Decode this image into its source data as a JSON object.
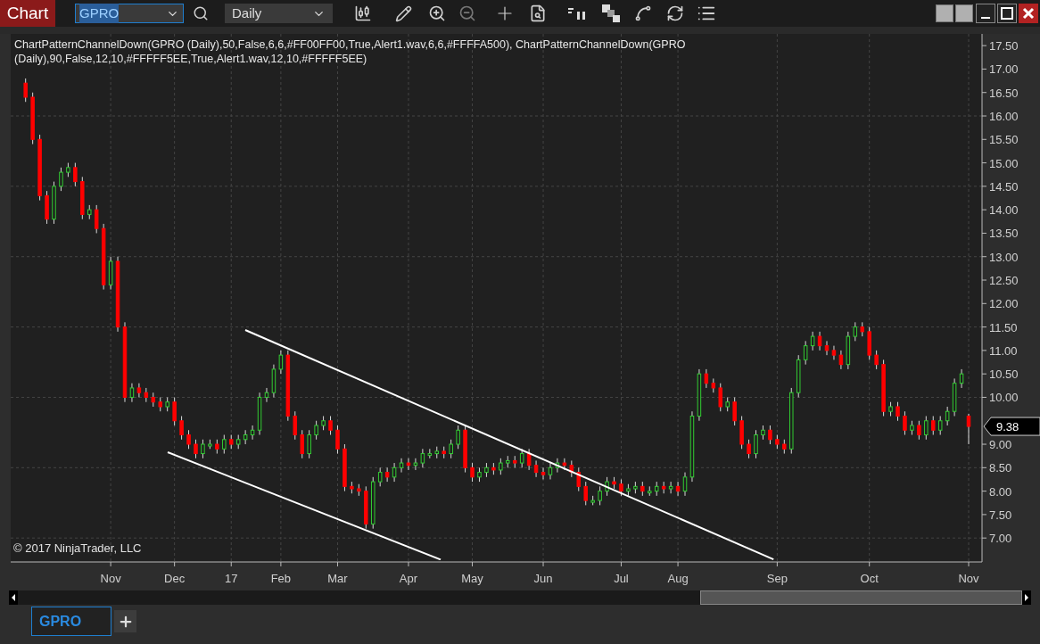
{
  "window": {
    "title": "Chart"
  },
  "toolbar": {
    "instrument": "GPRO",
    "interval": "Daily"
  },
  "chart": {
    "indicator_label_lines": [
      "ChartPatternChannelDown(GPRO (Daily),50,False,6,6,#FF00FF00,True,Alert1.wav,6,6,#FFFFA500), ChartPatternChannelDown(GPRO",
      "(Daily),90,False,12,10,#FFFFF5EE,True,Alert1.wav,12,10,#FFFFF5EE)"
    ],
    "copyright": "© 2017 NinjaTrader, LLC",
    "last_price": "9.38",
    "chart_data": {
      "type": "candlestick",
      "grid": true,
      "ylim": [
        6.49,
        17.75
      ],
      "yticks": [
        {
          "value": 7,
          "label": "7.00"
        },
        {
          "value": 7.5,
          "label": "7.50"
        },
        {
          "value": 8,
          "label": "8.00"
        },
        {
          "value": 8.5,
          "label": "8.50"
        },
        {
          "value": 9,
          "label": "9.00"
        },
        {
          "value": 10,
          "label": "10.00"
        },
        {
          "value": 10.5,
          "label": "10.50"
        },
        {
          "value": 11,
          "label": "11.00"
        },
        {
          "value": 11.5,
          "label": "11.50"
        },
        {
          "value": 12,
          "label": "12.00"
        },
        {
          "value": 12.5,
          "label": "12.50"
        },
        {
          "value": 13,
          "label": "13.00"
        },
        {
          "value": 13.5,
          "label": "13.50"
        },
        {
          "value": 14,
          "label": "14.00"
        },
        {
          "value": 14.5,
          "label": "14.50"
        },
        {
          "value": 15,
          "label": "15.00"
        },
        {
          "value": 15.5,
          "label": "15.50"
        },
        {
          "value": 16,
          "label": "16.00"
        },
        {
          "value": 16.5,
          "label": "16.50"
        },
        {
          "value": 17,
          "label": "17.00"
        },
        {
          "value": 17.5,
          "label": "17.50"
        }
      ],
      "categories": [
        null,
        null,
        null,
        null,
        null,
        null,
        null,
        null,
        null,
        null,
        null,
        null,
        "Nov",
        null,
        null,
        null,
        null,
        null,
        null,
        null,
        null,
        "Dec",
        null,
        null,
        null,
        null,
        null,
        null,
        null,
        "17",
        null,
        null,
        null,
        null,
        null,
        null,
        "Feb",
        null,
        null,
        null,
        null,
        null,
        null,
        null,
        "Mar",
        null,
        null,
        null,
        null,
        null,
        null,
        null,
        null,
        null,
        "Apr",
        null,
        null,
        null,
        null,
        null,
        null,
        null,
        null,
        "May",
        null,
        null,
        null,
        null,
        null,
        null,
        null,
        null,
        null,
        "Jun",
        null,
        null,
        null,
        null,
        null,
        null,
        null,
        null,
        null,
        null,
        "Jul",
        null,
        null,
        null,
        null,
        null,
        null,
        null,
        "Aug",
        null,
        null,
        null,
        null,
        null,
        null,
        null,
        null,
        null,
        null,
        null,
        null,
        null,
        "Sep",
        null,
        null,
        null,
        null,
        null,
        null,
        null,
        null,
        null,
        null,
        null,
        null,
        "Oct",
        null,
        null,
        null,
        null,
        null,
        null,
        null,
        null,
        null,
        null,
        null,
        null,
        null,
        "Nov"
      ],
      "ohlc": [
        [
          16.7,
          16.8,
          16.3,
          16.4
        ],
        [
          16.4,
          16.5,
          15.4,
          15.5
        ],
        [
          15.5,
          15.6,
          14.2,
          14.3
        ],
        [
          14.3,
          14.4,
          13.7,
          13.8
        ],
        [
          13.8,
          14.6,
          13.7,
          14.5
        ],
        [
          14.5,
          14.9,
          14.4,
          14.8
        ],
        [
          14.8,
          15.0,
          14.7,
          14.9
        ],
        [
          14.9,
          15.0,
          14.5,
          14.6
        ],
        [
          14.6,
          14.7,
          13.8,
          13.9
        ],
        [
          13.9,
          14.1,
          13.8,
          14.0
        ],
        [
          14.0,
          14.1,
          13.5,
          13.6
        ],
        [
          13.6,
          13.7,
          12.3,
          12.4
        ],
        [
          12.4,
          13.0,
          12.3,
          12.9
        ],
        [
          12.9,
          13.0,
          11.4,
          11.5
        ],
        [
          11.5,
          11.6,
          9.9,
          10.0
        ],
        [
          10.0,
          10.3,
          9.9,
          10.2
        ],
        [
          10.2,
          10.3,
          10.0,
          10.1
        ],
        [
          10.1,
          10.2,
          9.9,
          10.0
        ],
        [
          10.0,
          10.1,
          9.8,
          9.9
        ],
        [
          9.9,
          10.0,
          9.7,
          9.8
        ],
        [
          9.8,
          10.0,
          9.7,
          9.9
        ],
        [
          9.9,
          10.0,
          9.4,
          9.5
        ],
        [
          9.5,
          9.6,
          9.1,
          9.2
        ],
        [
          9.2,
          9.3,
          8.9,
          9.0
        ],
        [
          9.0,
          9.1,
          8.7,
          8.8
        ],
        [
          8.8,
          9.1,
          8.7,
          9.0
        ],
        [
          9.0,
          9.1,
          8.9,
          9.0
        ],
        [
          9.0,
          9.1,
          8.8,
          8.9
        ],
        [
          8.9,
          9.2,
          8.8,
          9.1
        ],
        [
          9.1,
          9.2,
          8.9,
          9.0
        ],
        [
          9.0,
          9.2,
          8.9,
          9.1
        ],
        [
          9.1,
          9.3,
          9.0,
          9.2
        ],
        [
          9.2,
          9.4,
          9.1,
          9.3
        ],
        [
          9.3,
          10.1,
          9.2,
          10.0
        ],
        [
          10.0,
          10.2,
          9.9,
          10.1
        ],
        [
          10.1,
          10.7,
          10.0,
          10.6
        ],
        [
          10.6,
          11.0,
          10.5,
          10.9
        ],
        [
          10.9,
          11.0,
          9.5,
          9.6
        ],
        [
          9.6,
          9.7,
          9.1,
          9.2
        ],
        [
          9.2,
          9.3,
          8.7,
          8.8
        ],
        [
          8.8,
          9.3,
          8.7,
          9.2
        ],
        [
          9.2,
          9.5,
          9.1,
          9.4
        ],
        [
          9.4,
          9.6,
          9.3,
          9.5
        ],
        [
          9.5,
          9.6,
          9.2,
          9.3
        ],
        [
          9.3,
          9.4,
          8.8,
          8.9
        ],
        [
          8.9,
          9.0,
          8.0,
          8.1
        ],
        [
          8.1,
          8.2,
          7.95,
          8.05
        ],
        [
          8.05,
          8.15,
          7.9,
          8.0
        ],
        [
          8.0,
          8.1,
          7.2,
          7.3
        ],
        [
          7.3,
          8.3,
          7.2,
          8.2
        ],
        [
          8.2,
          8.5,
          8.1,
          8.4
        ],
        [
          8.4,
          8.5,
          8.2,
          8.3
        ],
        [
          8.3,
          8.6,
          8.2,
          8.5
        ],
        [
          8.5,
          8.7,
          8.4,
          8.6
        ],
        [
          8.6,
          8.7,
          8.45,
          8.55
        ],
        [
          8.55,
          8.7,
          8.45,
          8.6
        ],
        [
          8.6,
          8.9,
          8.5,
          8.8
        ],
        [
          8.8,
          8.9,
          8.7,
          8.8
        ],
        [
          8.8,
          8.95,
          8.7,
          8.85
        ],
        [
          8.85,
          8.95,
          8.7,
          8.8
        ],
        [
          8.8,
          9.1,
          8.7,
          9.0
        ],
        [
          9.0,
          9.4,
          8.9,
          9.3
        ],
        [
          9.3,
          9.4,
          8.4,
          8.5
        ],
        [
          8.5,
          8.6,
          8.2,
          8.3
        ],
        [
          8.3,
          8.5,
          8.2,
          8.4
        ],
        [
          8.4,
          8.6,
          8.3,
          8.5
        ],
        [
          8.5,
          8.6,
          8.35,
          8.45
        ],
        [
          8.45,
          8.7,
          8.35,
          8.6
        ],
        [
          8.6,
          8.75,
          8.5,
          8.65
        ],
        [
          8.65,
          8.75,
          8.5,
          8.6
        ],
        [
          8.6,
          8.9,
          8.5,
          8.8
        ],
        [
          8.8,
          8.9,
          8.45,
          8.55
        ],
        [
          8.55,
          8.65,
          8.3,
          8.4
        ],
        [
          8.4,
          8.5,
          8.25,
          8.35
        ],
        [
          8.35,
          8.6,
          8.25,
          8.5
        ],
        [
          8.5,
          8.7,
          8.4,
          8.6
        ],
        [
          8.6,
          8.7,
          8.45,
          8.55
        ],
        [
          8.55,
          8.65,
          8.3,
          8.4
        ],
        [
          8.4,
          8.5,
          8.0,
          8.1
        ],
        [
          8.1,
          8.2,
          7.7,
          7.8
        ],
        [
          7.8,
          7.9,
          7.7,
          7.8
        ],
        [
          7.8,
          8.1,
          7.7,
          8.0
        ],
        [
          8.0,
          8.3,
          7.9,
          8.2
        ],
        [
          8.2,
          8.3,
          8.05,
          8.15
        ],
        [
          8.15,
          8.25,
          7.9,
          8.0
        ],
        [
          8.0,
          8.15,
          7.9,
          8.05
        ],
        [
          8.05,
          8.2,
          7.95,
          8.1
        ],
        [
          8.1,
          8.2,
          7.9,
          8.0
        ],
        [
          8.0,
          8.1,
          7.9,
          8.0
        ],
        [
          8.0,
          8.2,
          7.9,
          8.1
        ],
        [
          8.1,
          8.2,
          7.95,
          8.05
        ],
        [
          8.05,
          8.2,
          7.95,
          8.1
        ],
        [
          8.1,
          8.2,
          7.9,
          8.0
        ],
        [
          8.0,
          8.4,
          7.9,
          8.3
        ],
        [
          8.3,
          9.7,
          8.2,
          9.6
        ],
        [
          9.6,
          10.6,
          9.5,
          10.5
        ],
        [
          10.5,
          10.6,
          10.2,
          10.3
        ],
        [
          10.3,
          10.4,
          10.1,
          10.2
        ],
        [
          10.2,
          10.3,
          9.7,
          9.8
        ],
        [
          9.8,
          10.0,
          9.7,
          9.9
        ],
        [
          9.9,
          10.0,
          9.4,
          9.5
        ],
        [
          9.5,
          9.6,
          8.9,
          9.0
        ],
        [
          9.0,
          9.1,
          8.7,
          8.8
        ],
        [
          8.8,
          9.3,
          8.7,
          9.2
        ],
        [
          9.2,
          9.4,
          9.1,
          9.3
        ],
        [
          9.3,
          9.4,
          9.0,
          9.1
        ],
        [
          9.1,
          9.2,
          8.9,
          9.0
        ],
        [
          9.0,
          9.1,
          8.8,
          8.9
        ],
        [
          8.9,
          10.2,
          8.8,
          10.1
        ],
        [
          10.1,
          10.9,
          10.0,
          10.8
        ],
        [
          10.8,
          11.2,
          10.7,
          11.1
        ],
        [
          11.1,
          11.4,
          11.0,
          11.3
        ],
        [
          11.3,
          11.4,
          11.0,
          11.1
        ],
        [
          11.1,
          11.2,
          10.9,
          11.0
        ],
        [
          11.0,
          11.1,
          10.8,
          10.9
        ],
        [
          10.9,
          11.0,
          10.6,
          10.7
        ],
        [
          10.7,
          11.4,
          10.6,
          11.3
        ],
        [
          11.3,
          11.6,
          11.2,
          11.5
        ],
        [
          11.5,
          11.6,
          11.3,
          11.4
        ],
        [
          11.4,
          11.5,
          10.8,
          10.9
        ],
        [
          10.9,
          11.0,
          10.6,
          10.7
        ],
        [
          10.7,
          10.8,
          9.6,
          9.7
        ],
        [
          9.7,
          9.9,
          9.6,
          9.8
        ],
        [
          9.8,
          9.9,
          9.5,
          9.6
        ],
        [
          9.6,
          9.7,
          9.2,
          9.3
        ],
        [
          9.3,
          9.5,
          9.2,
          9.4
        ],
        [
          9.4,
          9.5,
          9.1,
          9.2
        ],
        [
          9.2,
          9.6,
          9.1,
          9.5
        ],
        [
          9.5,
          9.6,
          9.2,
          9.3
        ],
        [
          9.3,
          9.6,
          9.2,
          9.5
        ],
        [
          9.5,
          9.8,
          9.4,
          9.7
        ],
        [
          9.7,
          10.4,
          9.6,
          10.3
        ],
        [
          10.3,
          10.6,
          10.2,
          10.5
        ],
        [
          9.6,
          9.65,
          9.0,
          9.38
        ]
      ]
    }
  },
  "tabs": [
    {
      "label": "GPRO",
      "selected": true
    }
  ]
}
